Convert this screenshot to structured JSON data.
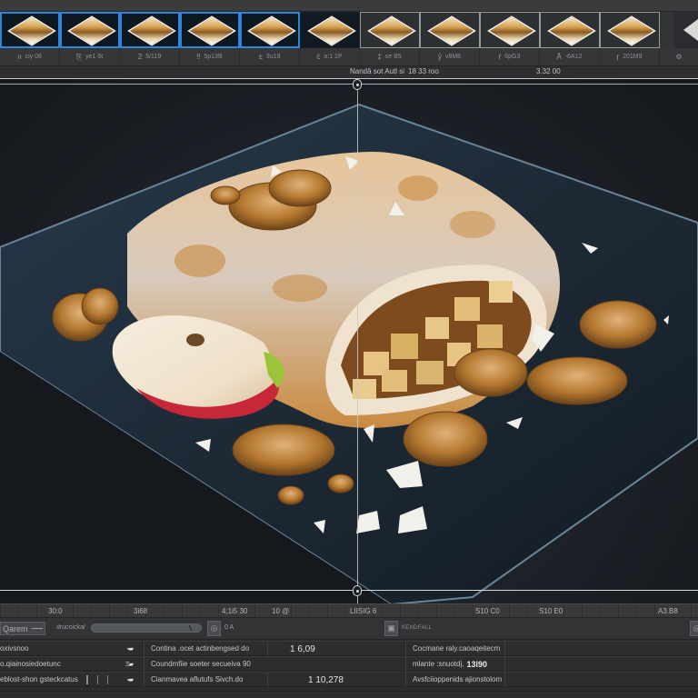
{
  "filmstrip": {
    "thumbnails": [
      {
        "state": "selected"
      },
      {
        "state": "selected"
      },
      {
        "state": "selected"
      },
      {
        "state": "selected"
      },
      {
        "state": "selected"
      },
      {
        "state": "normal"
      },
      {
        "state": "plain"
      },
      {
        "state": "plain"
      },
      {
        "state": "plain"
      },
      {
        "state": "plain"
      },
      {
        "state": "plain"
      }
    ],
    "labels": [
      {
        "icon": "ıı",
        "text": "ciy 08"
      },
      {
        "icon": "⎘",
        "text": "ye1 6t"
      },
      {
        "icon": "2",
        "text": "5/119"
      },
      {
        "icon": "‼",
        "text": "5p13B"
      },
      {
        "icon": "±",
        "text": "3u19"
      },
      {
        "icon": "ċ",
        "text": "a:1 1P"
      },
      {
        "icon": "‡",
        "text": "se B5"
      },
      {
        "icon": "ŷ",
        "text": "v8M8"
      },
      {
        "icon": "ŕ",
        "text": "6pG3"
      },
      {
        "icon": "Ā",
        "text": "-6A12"
      },
      {
        "icon": "ŗ",
        "text": "201M9"
      }
    ],
    "end_icon": "⚙",
    "next_arrow": "next-icon"
  },
  "status_bar": {
    "title": "Nandâ sot Autl si",
    "duration": "18 33 roo",
    "timecode": "3.32 00"
  },
  "ruler": {
    "ticks": [
      "30:0",
      "3i68",
      "4;1i5 30",
      "10 @",
      "LIISIG 6",
      "S10 C0",
      "S10 E0",
      "A3.B8"
    ]
  },
  "controls": {
    "mode_button": "Qarem",
    "slider_label": "drucoickal",
    "slider_value": 0.95,
    "zero_label": "0 A",
    "keyframe_label": "KENDFALL"
  },
  "props_left": [
    {
      "label": "oxivsnoo",
      "value": "▪▰"
    },
    {
      "label": "o.qiainosiedoetunc",
      "value": "Ξ▰"
    },
    {
      "label": "eblost-shon gsteckcatus",
      "value": "▪▰"
    }
  ],
  "props_mid": [
    {
      "label": "Contina .ocet actinbengsed do",
      "value": "1 6,09"
    },
    {
      "label": "Coundmfiie soeter secueiva 90",
      "value": ""
    },
    {
      "label": "Cianmavea aflutufs Sivch.do",
      "value": "1 10,278"
    }
  ],
  "props_right": [
    {
      "label": "Cocmane raly.caoaqeitecm",
      "bold": ""
    },
    {
      "label": "mlante :snuotdj,",
      "bold": "13l90"
    },
    {
      "label": "Avsfciioppenids ajionstolom",
      "bold": ""
    }
  ],
  "colors": {
    "selection_accent": "#2f86d8",
    "panel_bg": "#323335",
    "canvas_bg": "#1b2026"
  }
}
